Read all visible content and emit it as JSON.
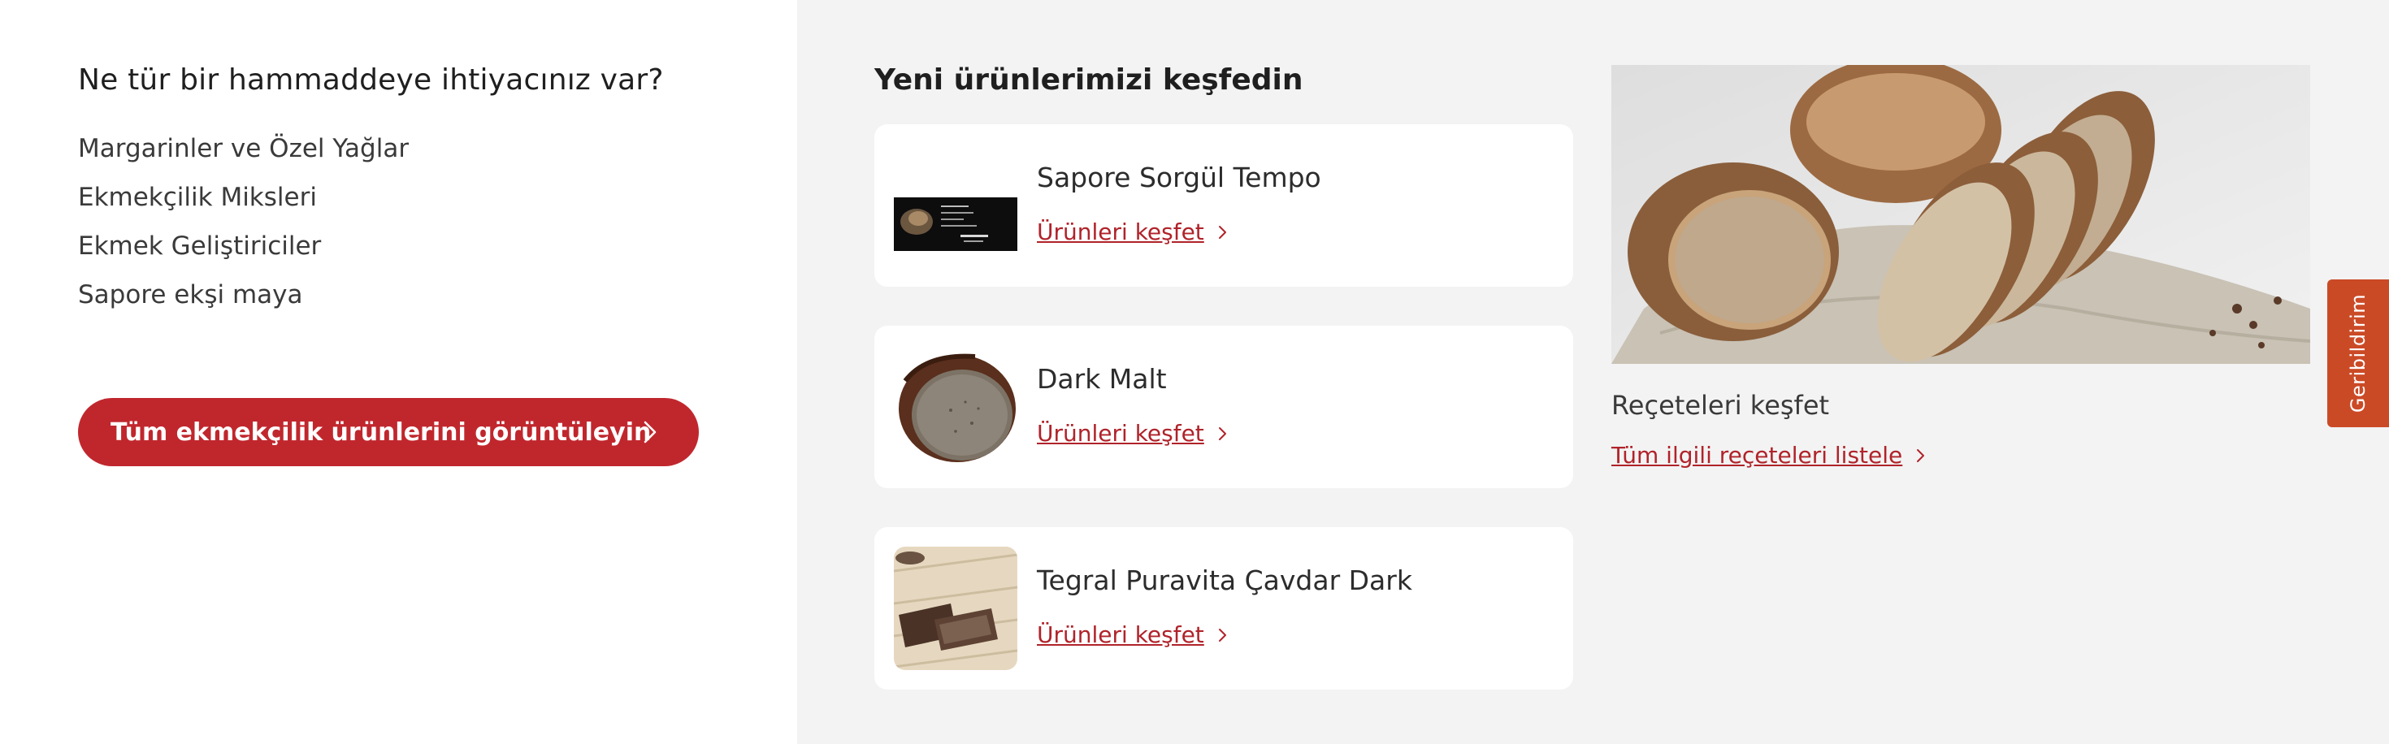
{
  "left": {
    "heading": "Ne tür bir hammaddeye ihtiyacınız var?",
    "categories": [
      "Margarinler ve Özel Yağlar",
      "Ekmekçilik Miksleri",
      "Ekmek Geliştiriciler",
      "Sapore ekşi maya"
    ],
    "cta_label": "Tüm ekmekçilik ürünlerini görüntüleyin"
  },
  "new_products": {
    "heading": "Yeni ürünlerimizi keşfedin",
    "items": [
      {
        "name": "Sapore Sorgül Tempo",
        "link": "Ürünleri keşfet"
      },
      {
        "name": "Dark Malt",
        "link": "Ürünleri keşfet"
      },
      {
        "name": "Tegral Puravita Çavdar Dark",
        "link": "Ürünleri keşfet"
      }
    ]
  },
  "recipes": {
    "title": "Reçeteleri keşfet",
    "link": "Tüm ilgili reçeteleri listele"
  },
  "feedback": {
    "label": "Geribildirim"
  },
  "colors": {
    "brand_red": "#c0272d",
    "link_red": "#b0232a",
    "feedback_orange": "#cb4a26",
    "panel_gray": "#f3f3f3"
  },
  "icons": {
    "cta": "chevron-right-icon",
    "link": "chevron-right-icon"
  }
}
